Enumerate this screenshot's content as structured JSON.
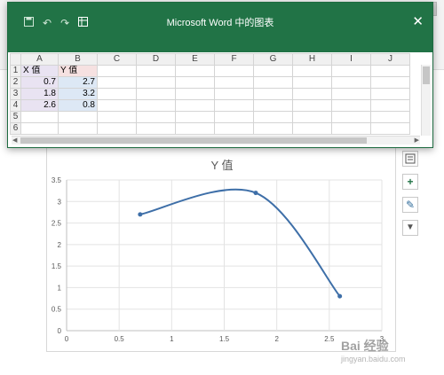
{
  "window": {
    "title": "Microsoft Word 中的图表",
    "close_icon": "✕"
  },
  "sheet": {
    "columns": [
      "A",
      "B",
      "C",
      "D",
      "E",
      "F",
      "G",
      "H",
      "I",
      "J"
    ],
    "rows": [
      [
        "X 值",
        "Y 值"
      ],
      [
        "0.7",
        "2.7"
      ],
      [
        "1.8",
        "3.2"
      ],
      [
        "2.6",
        "0.8"
      ],
      [
        "",
        ""
      ],
      [
        "",
        ""
      ]
    ],
    "row_headers": [
      "1",
      "2",
      "3",
      "4",
      "5",
      "6"
    ]
  },
  "chart_data": {
    "type": "scatter",
    "title": "Y 值",
    "x": [
      0.7,
      1.8,
      2.6
    ],
    "y": [
      2.7,
      3.2,
      0.8
    ],
    "smooth_line": true,
    "xlim": [
      0,
      3
    ],
    "ylim": [
      0,
      3.5
    ],
    "xticks": [
      "0",
      "0.5",
      "1",
      "1.5",
      "2",
      "2.5",
      "3"
    ],
    "yticks": [
      "0",
      "0.5",
      "1",
      "1.5",
      "2",
      "2.5",
      "3",
      "3.5"
    ],
    "grid": true,
    "series_color": "#3e6fa8"
  },
  "chart_buttons": {
    "layout_icon": "chart-layout-icon",
    "add_icon": "+",
    "style_icon": "✎",
    "filter_icon": "▼"
  },
  "watermark": {
    "logo": "Bai 经验",
    "url": "jingyan.baidu.com"
  }
}
